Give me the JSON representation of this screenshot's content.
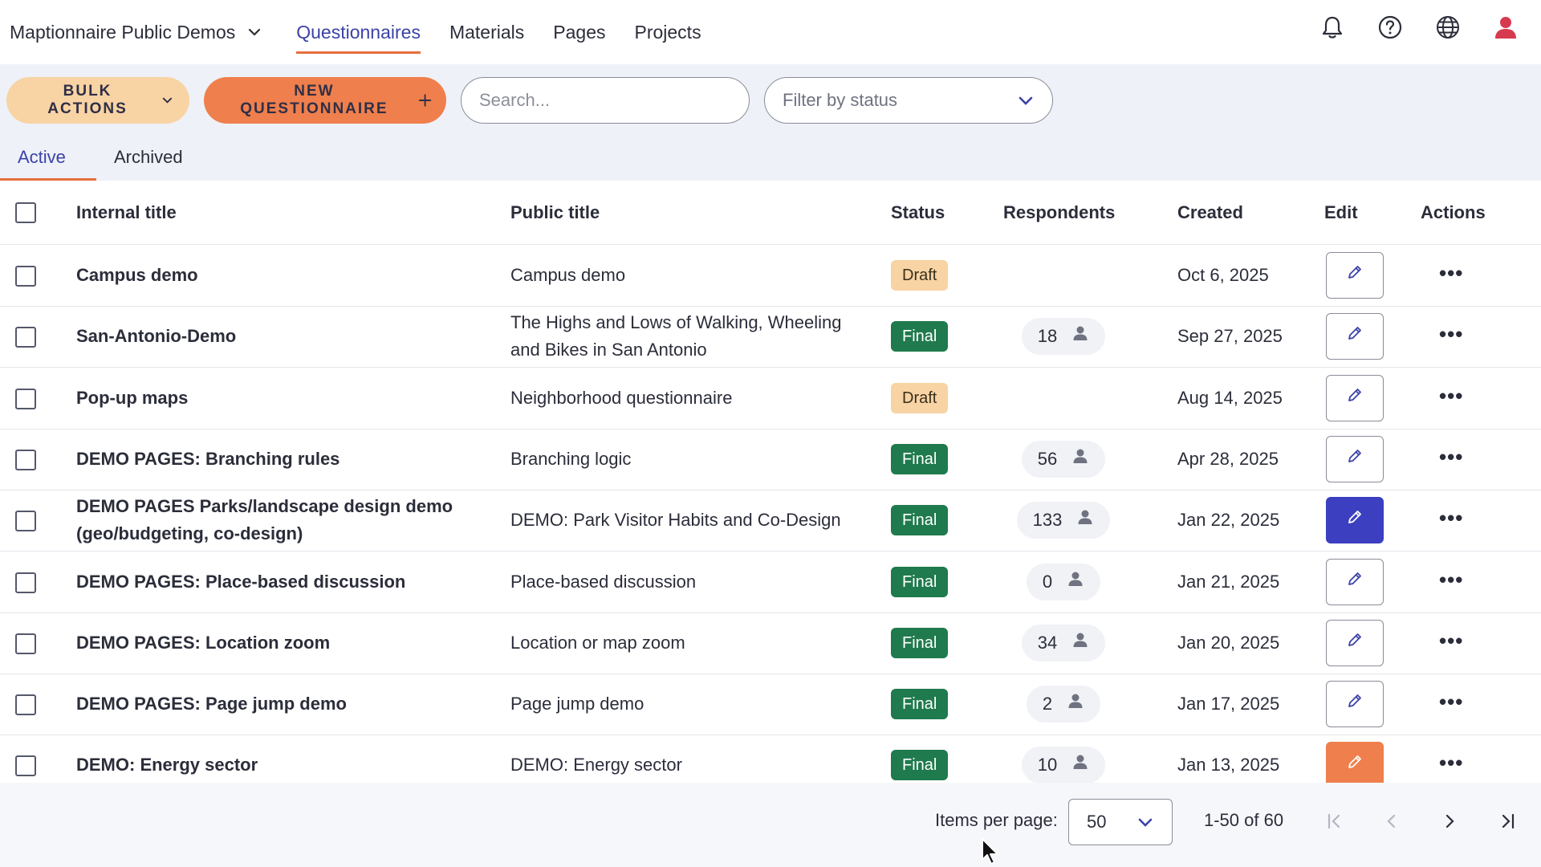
{
  "topnav": {
    "org": "Maptionnaire Public Demos",
    "items": [
      {
        "label": "Questionnaires",
        "active": true
      },
      {
        "label": "Materials",
        "active": false
      },
      {
        "label": "Pages",
        "active": false
      },
      {
        "label": "Projects",
        "active": false
      }
    ],
    "icons": [
      "bell-icon",
      "help-icon",
      "globe-icon",
      "user-icon"
    ]
  },
  "toolbar": {
    "bulk_label": "BULK ACTIONS",
    "new_label": "NEW QUESTIONNAIRE",
    "search_placeholder": "Search...",
    "filter_label": "Filter by status"
  },
  "tabs": [
    {
      "label": "Active",
      "active": true
    },
    {
      "label": "Archived",
      "active": false
    }
  ],
  "table": {
    "headers": {
      "internal": "Internal title",
      "public": "Public title",
      "status": "Status",
      "respondents": "Respondents",
      "created": "Created",
      "edit": "Edit",
      "actions": "Actions"
    },
    "rows": [
      {
        "internal": "Campus demo",
        "public": "Campus demo",
        "status": "Draft",
        "respondents": "",
        "created": "Oct 6, 2025",
        "edit_style": "default"
      },
      {
        "internal": "San-Antonio-Demo",
        "public": "The Highs and Lows of Walking, Wheeling and Bikes in San Antonio",
        "status": "Final",
        "respondents": "18",
        "created": "Sep 27, 2025",
        "edit_style": "default"
      },
      {
        "internal": "Pop-up maps",
        "public": "Neighborhood questionnaire",
        "status": "Draft",
        "respondents": "",
        "created": "Aug 14, 2025",
        "edit_style": "default"
      },
      {
        "internal": "DEMO PAGES: Branching rules",
        "public": "Branching logic",
        "status": "Final",
        "respondents": "56",
        "created": "Apr 28, 2025",
        "edit_style": "default"
      },
      {
        "internal": "DEMO PAGES Parks/landscape design demo (geo/budgeting, co-design)",
        "public": "DEMO: Park Visitor Habits and Co-Design",
        "status": "Final",
        "respondents": "133",
        "created": "Jan 22, 2025",
        "edit_style": "primary"
      },
      {
        "internal": "DEMO PAGES: Place-based discussion",
        "public": "Place-based discussion",
        "status": "Final",
        "respondents": "0",
        "created": "Jan 21, 2025",
        "edit_style": "default"
      },
      {
        "internal": "DEMO PAGES: Location zoom",
        "public": "Location or map zoom",
        "status": "Final",
        "respondents": "34",
        "created": "Jan 20, 2025",
        "edit_style": "default"
      },
      {
        "internal": "DEMO PAGES: Page jump demo",
        "public": "Page jump demo",
        "status": "Final",
        "respondents": "2",
        "created": "Jan 17, 2025",
        "edit_style": "default"
      },
      {
        "internal": "DEMO: Energy sector",
        "public": "DEMO: Energy sector",
        "status": "Final",
        "respondents": "10",
        "created": "Jan 13, 2025",
        "edit_style": "orange"
      }
    ]
  },
  "footer": {
    "items_per_page_label": "Items per page:",
    "items_per_page_value": "50",
    "range": "1-50 of 60"
  },
  "colors": {
    "accent": "#3b42a8",
    "orange": "#ef7f4c",
    "draft": "#f8d3a4",
    "final": "#1f7a4d"
  }
}
